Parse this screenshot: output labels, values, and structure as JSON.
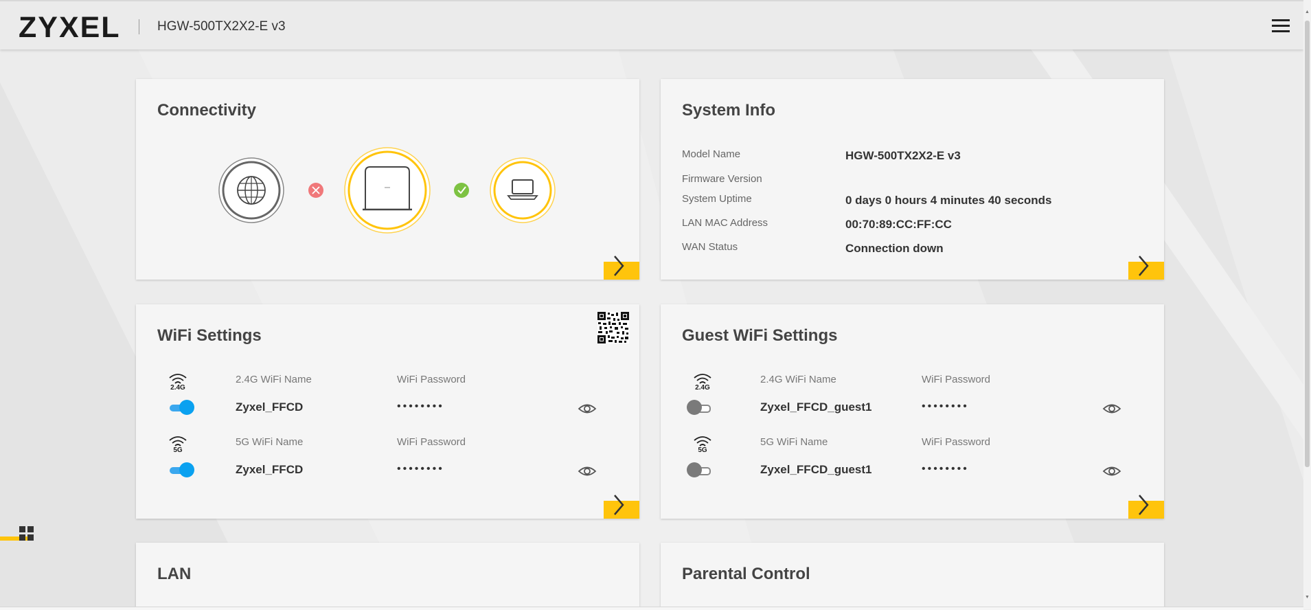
{
  "header": {
    "brand": "ZYXEL",
    "model": "HGW-500TX2X2-E v3",
    "menu_icon": "hamburger-icon"
  },
  "connectivity": {
    "title": "Connectivity",
    "internet_status": "error",
    "lan_status": "ok",
    "colors": {
      "accent": "#ffc40c",
      "error": "#f0787a",
      "ok": "#7dc242"
    }
  },
  "system_info": {
    "title": "System Info",
    "rows": [
      {
        "label": "Model Name",
        "value": "HGW-500TX2X2-E v3"
      },
      {
        "label": "Firmware Version",
        "value": ""
      },
      {
        "label": "System Uptime",
        "value": "0 days 0 hours 4 minutes 40 seconds"
      },
      {
        "label": "LAN MAC Address",
        "value": "00:70:89:CC:FF:CC"
      },
      {
        "label": "WAN Status",
        "value": "Connection down"
      }
    ]
  },
  "wifi": {
    "title": "WiFi Settings",
    "bands": [
      {
        "band": "2.4G",
        "name_label": "2.4G WiFi Name",
        "ssid": "Zyxel_FFCD",
        "password_label": "WiFi Password",
        "password_mask": "••••••••",
        "enabled": true
      },
      {
        "band": "5G",
        "name_label": "5G WiFi Name",
        "ssid": "Zyxel_FFCD",
        "password_label": "WiFi Password",
        "password_mask": "••••••••",
        "enabled": true
      }
    ]
  },
  "guest_wifi": {
    "title": "Guest WiFi Settings",
    "bands": [
      {
        "band": "2.4G",
        "name_label": "2.4G WiFi Name",
        "ssid": "Zyxel_FFCD_guest1",
        "password_label": "WiFi Password",
        "password_mask": "••••••••",
        "enabled": false
      },
      {
        "band": "5G",
        "name_label": "5G WiFi Name",
        "ssid": "Zyxel_FFCD_guest1",
        "password_label": "WiFi Password",
        "password_mask": "••••••••",
        "enabled": false
      }
    ]
  },
  "lan": {
    "title": "LAN"
  },
  "parental": {
    "title": "Parental Control"
  }
}
